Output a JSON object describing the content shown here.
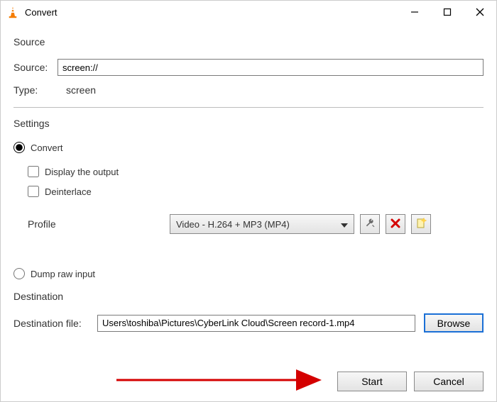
{
  "titlebar": {
    "title": "Convert"
  },
  "source": {
    "section_label": "Source",
    "source_label": "Source:",
    "source_value": "screen://",
    "type_label": "Type:",
    "type_value": "screen"
  },
  "settings": {
    "section_label": "Settings",
    "convert_label": "Convert",
    "display_output_label": "Display the output",
    "deinterlace_label": "Deinterlace",
    "profile_label": "Profile",
    "profile_selected": "Video - H.264 + MP3 (MP4)",
    "dump_raw_label": "Dump raw input",
    "icons": {
      "edit": "edit-profile-icon",
      "delete": "delete-profile-icon",
      "new": "new-profile-icon"
    }
  },
  "destination": {
    "section_label": "Destination",
    "file_label": "Destination file:",
    "file_value": "Users\\toshiba\\Pictures\\CyberLink Cloud\\Screen record-1.mp4",
    "browse_label": "Browse"
  },
  "footer": {
    "start_label": "Start",
    "cancel_label": "Cancel"
  }
}
